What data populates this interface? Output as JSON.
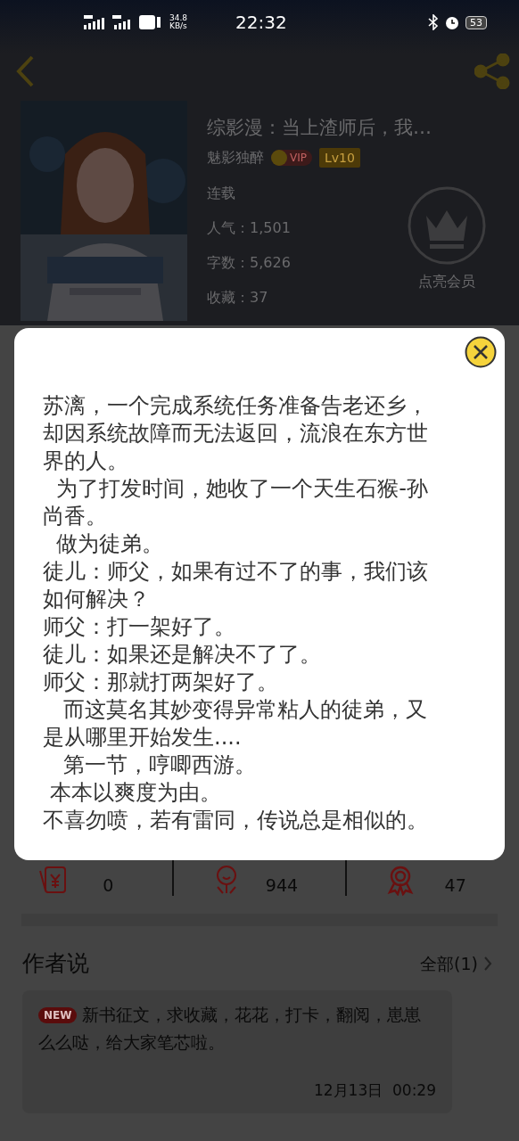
{
  "status_bar": {
    "speed": "34.8",
    "speed_unit": "KB/s",
    "time": "22:32",
    "battery": "53"
  },
  "book": {
    "title": "综影漫：当上渣师后，我…",
    "author": "魅影独醉",
    "vip": "VIP",
    "level": "Lv10",
    "status": "连载",
    "stats": [
      "人气：1,501",
      "字数：5,626",
      "收藏：37"
    ],
    "member_label": "点亮会员"
  },
  "counters": [
    {
      "kind": "coin",
      "value": "0"
    },
    {
      "kind": "flower",
      "value": "944"
    },
    {
      "kind": "medal",
      "value": "47"
    }
  ],
  "author_notes": {
    "heading": "作者说",
    "more": "全部(1)",
    "note": {
      "badge": "NEW",
      "text": "新书征文，求收藏，花花，打卡，翻阅，崽崽么么哒，给大家笔芯啦。",
      "time": "12月13日  00:29"
    }
  },
  "dialog": {
    "paragraphs": [
      "苏漓，一个完成系统任务准备告老还乡，却因系统故障而无法返回，流浪在东方世界的人。",
      "  为了打发时间，她收了一个天生石猴-孙尚香。",
      "  做为徒弟。",
      "徒儿：师父，如果有过不了的事，我们该如何解决？",
      "师父：打一架好了。",
      "徒儿：如果还是解决不了了。",
      "师父：那就打两架好了。",
      "   而这莫名其妙变得异常粘人的徒弟，又是从哪里开始发生....",
      "   第一节，哼唧西游。",
      " 本本以爽度为由。",
      "不喜勿喷，若有雷同，传说总是相似的。"
    ]
  }
}
